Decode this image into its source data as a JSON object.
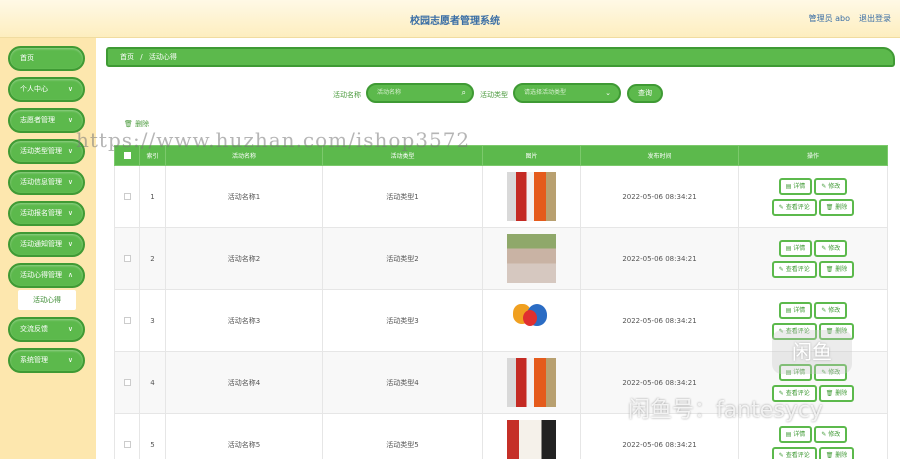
{
  "header": {
    "title": "校园志愿者管理系统",
    "admin_label": "管理员 abo",
    "logout_label": "退出登录"
  },
  "sidebar": {
    "items": [
      {
        "label": "首页",
        "chevron": false
      },
      {
        "label": "个人中心",
        "chevron": true
      },
      {
        "label": "志愿者管理",
        "chevron": true
      },
      {
        "label": "活动类型管理",
        "chevron": true
      },
      {
        "label": "活动信息管理",
        "chevron": true
      },
      {
        "label": "活动报名管理",
        "chevron": true
      },
      {
        "label": "活动通知管理",
        "chevron": true
      },
      {
        "label": "活动心得管理",
        "chevron": true
      },
      {
        "label": "交流反馈",
        "chevron": true
      },
      {
        "label": "系统管理",
        "chevron": true
      }
    ],
    "active_sub": "活动心得"
  },
  "breadcrumb": {
    "home": "首页",
    "sep": "/",
    "current": "活动心得"
  },
  "search": {
    "name_label": "活动名称",
    "name_placeholder": "活动名称",
    "type_label": "活动类型",
    "type_placeholder": "请选择活动类型",
    "query_label": "查询"
  },
  "toolbar": {
    "delete_label": "删除"
  },
  "table": {
    "headers": [
      "索引",
      "活动名称",
      "活动类型",
      "图片",
      "发布时间",
      "操作"
    ],
    "rows": [
      {
        "index": "1",
        "name": "活动名称1",
        "type": "活动类型1",
        "time": "2022-05-06 08:34:21"
      },
      {
        "index": "2",
        "name": "活动名称2",
        "type": "活动类型2",
        "time": "2022-05-06 08:34:21"
      },
      {
        "index": "3",
        "name": "活动名称3",
        "type": "活动类型3",
        "time": "2022-05-06 08:34:21"
      },
      {
        "index": "4",
        "name": "活动名称4",
        "type": "活动类型4",
        "time": "2022-05-06 08:34:21"
      },
      {
        "index": "5",
        "name": "活动名称5",
        "type": "活动类型5",
        "time": "2022-05-06 08:34:21"
      }
    ],
    "actions": {
      "detail": "详情",
      "edit": "修改",
      "comments": "查看评论",
      "delete": "删除"
    }
  },
  "watermarks": {
    "url": "https://www.huzhan.com/ishop3572",
    "seller": "闲鱼号：fantesycy",
    "badge": "闲鱼"
  },
  "colors": {
    "primary": "#5cb94c",
    "primary_dark": "#3f9a34",
    "sidebar_bg": "#fde7ae",
    "link": "#3a6ea5"
  }
}
